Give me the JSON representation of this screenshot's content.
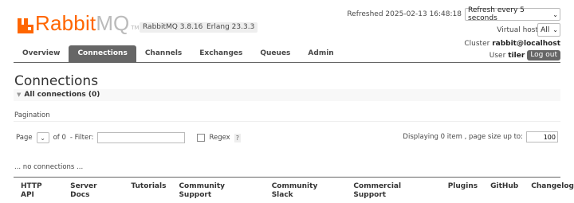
{
  "header": {
    "logo_text_rabbit": "Rabbit",
    "logo_text_mq": "MQ",
    "logo_tm": "TM",
    "rabbitmq_version": "RabbitMQ 3.8.16",
    "erlang_version": "Erlang 23.3.3",
    "refreshed_label": "Refreshed 2025-02-13 16:48:18",
    "refresh_select_value": "Refresh every 5 seconds",
    "vhost_label": "Virtual host",
    "vhost_select_value": "All",
    "cluster_label": "Cluster",
    "cluster_name": "rabbit@localhost",
    "user_label": "User",
    "user_name": "tiler",
    "logout_label": "Log out",
    "brand_color": "#ff6600"
  },
  "nav": {
    "tabs": [
      {
        "label": "Overview"
      },
      {
        "label": "Connections"
      },
      {
        "label": "Channels"
      },
      {
        "label": "Exchanges"
      },
      {
        "label": "Queues"
      },
      {
        "label": "Admin"
      }
    ],
    "active": "Connections"
  },
  "main": {
    "title": "Connections",
    "section_title": "All connections (0)",
    "pagination_label": "Pagination",
    "page_label": "Page",
    "page_of": "of 0",
    "filter_label": "- Filter:",
    "filter_value": "",
    "regex_label": "Regex",
    "regex_help": "?",
    "displaying_label": "Displaying 0 item , page size up to:",
    "page_size_value": "100",
    "no_connections": "... no connections ..."
  },
  "footer": {
    "links": [
      "HTTP API",
      "Server Docs",
      "Tutorials",
      "Community Support",
      "Community Slack",
      "Commercial Support",
      "Plugins",
      "GitHub",
      "Changelog"
    ]
  }
}
